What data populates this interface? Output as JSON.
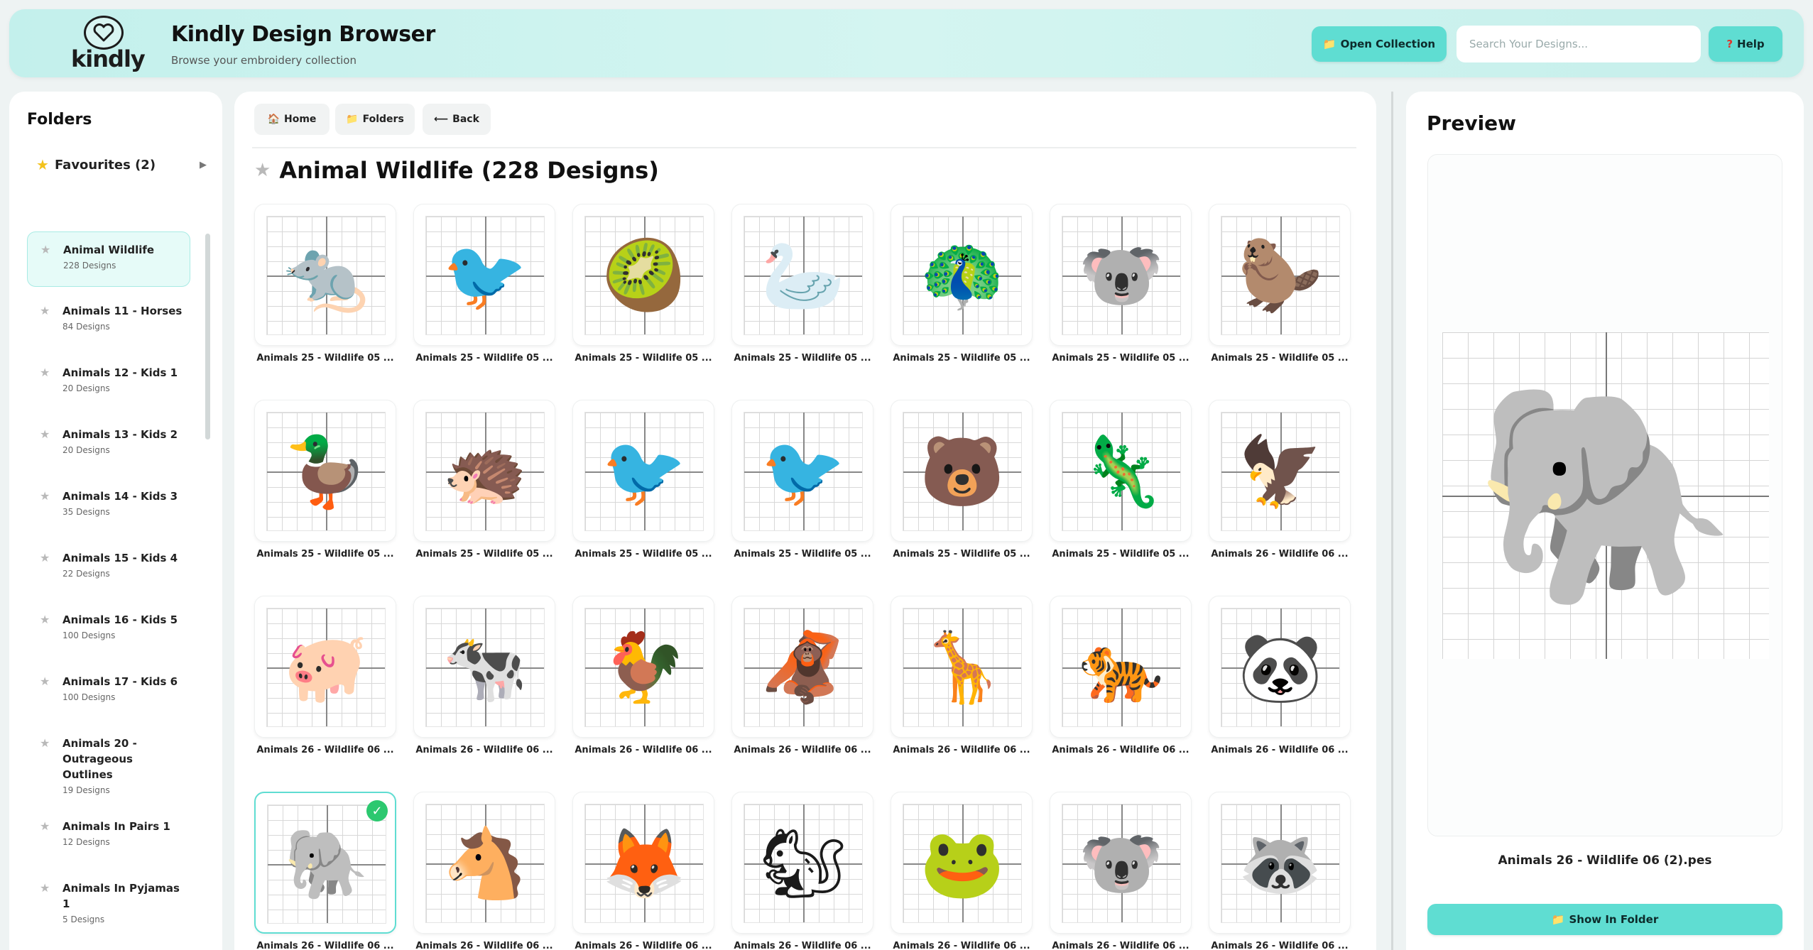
{
  "header": {
    "logo_text": "kindly",
    "title": "Kindly Design Browser",
    "subtitle": "Browse your embroidery collection",
    "open_collection_label": "Open Collection",
    "search_placeholder": "Search Your Designs...",
    "help_label": "Help",
    "accent_color": "#5fddd2"
  },
  "sidebar": {
    "title": "Folders",
    "favourites_label": "Favourites (2)",
    "folders": [
      {
        "name": "Animal Wildlife",
        "count": "228 Designs",
        "active": true
      },
      {
        "name": "Animals 11 - Horses",
        "count": "84 Designs"
      },
      {
        "name": "Animals 12 - Kids 1",
        "count": "20 Designs"
      },
      {
        "name": "Animals 13 - Kids 2",
        "count": "20 Designs"
      },
      {
        "name": "Animals 14 - Kids 3",
        "count": "35 Designs"
      },
      {
        "name": "Animals 15 - Kids 4",
        "count": "22 Designs"
      },
      {
        "name": "Animals 16 - Kids 5",
        "count": "100 Designs"
      },
      {
        "name": "Animals 17 - Kids 6",
        "count": "100 Designs"
      },
      {
        "name": "Animals 20 - Outrageous Outlines",
        "count": "19 Designs"
      },
      {
        "name": "Animals In Pairs 1",
        "count": "12 Designs"
      },
      {
        "name": "Animals In Pyjamas 1",
        "count": "5 Designs"
      }
    ]
  },
  "main": {
    "nav": {
      "home": "Home",
      "folders": "Folders",
      "back": "Back"
    },
    "heading": "Animal Wildlife (228 Designs)",
    "designs": [
      {
        "caption": "Animals 25 - Wildlife 05 ...",
        "icon": "🐀",
        "icon_name": "bilby-icon"
      },
      {
        "caption": "Animals 25 - Wildlife 05 ...",
        "icon": "🐦",
        "icon_name": "pelican-icon"
      },
      {
        "caption": "Animals 25 - Wildlife 05 ...",
        "icon": "🥝",
        "icon_name": "kiwi-icon"
      },
      {
        "caption": "Animals 25 - Wildlife 05 ...",
        "icon": "🦢",
        "icon_name": "black-swan-icon"
      },
      {
        "caption": "Animals 25 - Wildlife 05 ...",
        "icon": "🦚",
        "icon_name": "lyrebird-icon"
      },
      {
        "caption": "Animals 25 - Wildlife 05 ...",
        "icon": "🐨",
        "icon_name": "koala-icon"
      },
      {
        "caption": "Animals 25 - Wildlife 05 ...",
        "icon": "🦫",
        "icon_name": "wombat-icon"
      },
      {
        "caption": "Animals 25 - Wildlife 05 ...",
        "icon": "🦆",
        "icon_name": "platypus-icon"
      },
      {
        "caption": "Animals 25 - Wildlife 05 ...",
        "icon": "🦔",
        "icon_name": "echidna-icon"
      },
      {
        "caption": "Animals 25 - Wildlife 05 ...",
        "icon": "🐦",
        "icon_name": "kookaburra-icon"
      },
      {
        "caption": "Animals 25 - Wildlife 05 ...",
        "icon": "🐦",
        "icon_name": "emu-icon"
      },
      {
        "caption": "Animals 25 - Wildlife 05 ...",
        "icon": "🐻",
        "icon_name": "tasmanian-devil-icon"
      },
      {
        "caption": "Animals 25 - Wildlife 05 ...",
        "icon": "🦎",
        "icon_name": "frilled-lizard-icon"
      },
      {
        "caption": "Animals 26 - Wildlife 06 ...",
        "icon": "🦅",
        "icon_name": "eagle-icon"
      },
      {
        "caption": "Animals 26 - Wildlife 06 ...",
        "icon": "🐖",
        "icon_name": "pig-icon"
      },
      {
        "caption": "Animals 26 - Wildlife 06 ...",
        "icon": "🐄",
        "icon_name": "cow-icon"
      },
      {
        "caption": "Animals 26 - Wildlife 06 ...",
        "icon": "🐓",
        "icon_name": "rooster-icon"
      },
      {
        "caption": "Animals 26 - Wildlife 06 ...",
        "icon": "🦧",
        "icon_name": "orangutan-icon"
      },
      {
        "caption": "Animals 26 - Wildlife 06 ...",
        "icon": "🦒",
        "icon_name": "giraffe-icon"
      },
      {
        "caption": "Animals 26 - Wildlife 06 ...",
        "icon": "🐅",
        "icon_name": "tiger-icon"
      },
      {
        "caption": "Animals 26 - Wildlife 06 ...",
        "icon": "🐼",
        "icon_name": "panda-icon"
      },
      {
        "caption": "Animals 26 - Wildlife 06 ...",
        "icon": "🐘",
        "icon_name": "elephant-icon",
        "selected": true
      },
      {
        "caption": "Animals 26 - Wildlife 06 ...",
        "icon": "🐴",
        "icon_name": "horse-icon"
      },
      {
        "caption": "Animals 26 - Wildlife 06 ...",
        "icon": "🦊",
        "icon_name": "fox-icon"
      },
      {
        "caption": "Animals 26 - Wildlife 06 ...",
        "icon": "🐿",
        "icon_name": "chipmunk-icon"
      },
      {
        "caption": "Animals 26 - Wildlife 06 ...",
        "icon": "🐸",
        "icon_name": "frog-icon"
      },
      {
        "caption": "Animals 26 - Wildlife 06 ...",
        "icon": "🐨",
        "icon_name": "koala-branch-icon"
      },
      {
        "caption": "Animals 26 - Wildlife 06 ...",
        "icon": "🦝",
        "icon_name": "raccoon-icon"
      }
    ]
  },
  "preview": {
    "title": "Preview",
    "icon": "🐘",
    "filename": "Animals 26 - Wildlife 06 (2).pes",
    "show_folder_label": "Show In Folder"
  }
}
